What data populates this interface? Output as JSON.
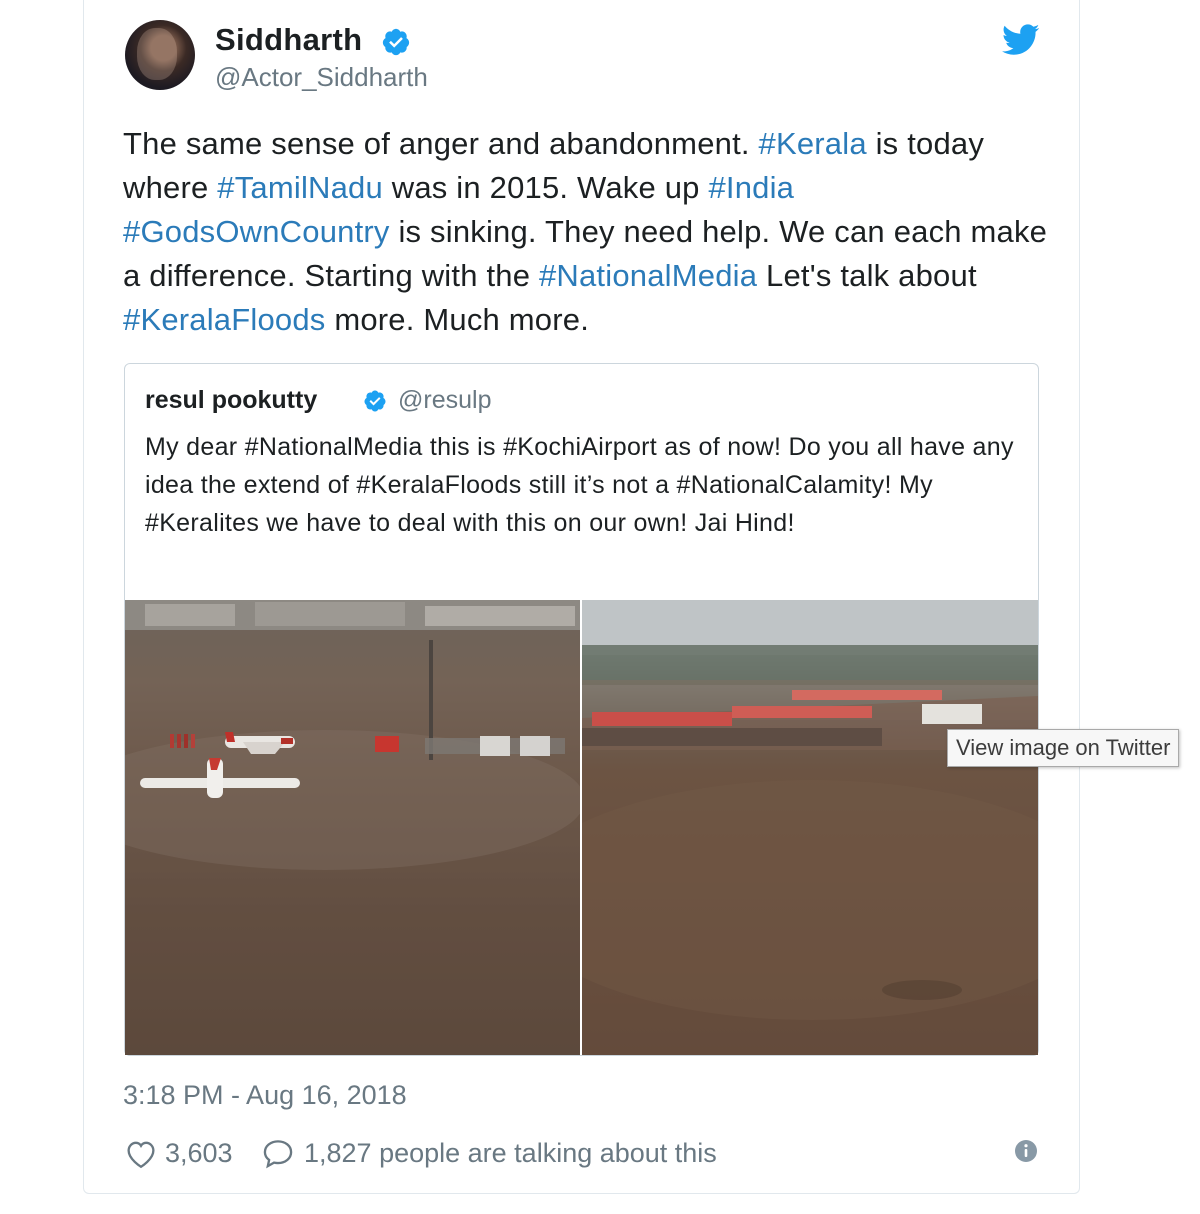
{
  "author": {
    "name": "Siddharth",
    "handle": "@Actor_Siddharth",
    "verified": true
  },
  "tweet": {
    "segments": [
      {
        "text": "The same sense of anger and abandonment. ",
        "tag": false
      },
      {
        "text": "#Kerala",
        "tag": true
      },
      {
        "text": " is today where ",
        "tag": false
      },
      {
        "text": "#TamilNadu",
        "tag": true
      },
      {
        "text": " was in 2015. Wake up ",
        "tag": false
      },
      {
        "text": "#India",
        "tag": true
      },
      {
        "text": " ",
        "tag": false
      },
      {
        "text": "#GodsOwnCountry",
        "tag": true
      },
      {
        "text": " is sinking. They need help. We can each make a difference. Starting with the ",
        "tag": false
      },
      {
        "text": "#NationalMedia",
        "tag": true
      },
      {
        "text": " Let's talk about ",
        "tag": false
      },
      {
        "text": "#KeralaFloods",
        "tag": true
      },
      {
        "text": " more. Much more.",
        "tag": false
      }
    ]
  },
  "quoted": {
    "name": "resul pookutty",
    "handle": "@resulp",
    "verified": true,
    "text": "My dear #NationalMedia this is #KochiAirport as of now! Do you all have any idea the extend of #KeralaFloods  still it’s not a #NationalCalamity! My #Keralites we have to deal with this on our own! Jai Hind!"
  },
  "tooltip": "View image on Twitter",
  "timestamp": "3:18 PM - Aug 16, 2018",
  "likes": "3,603",
  "talking": "1,827 people are talking about this",
  "colors": {
    "accent": "#2b7bb9",
    "twitter_blue": "#1da1f2",
    "muted": "#697882",
    "border": "#e1e8ed"
  },
  "icons": [
    "verified-badge-icon",
    "twitter-bird-icon",
    "heart-icon",
    "speech-bubble-icon",
    "info-icon"
  ]
}
